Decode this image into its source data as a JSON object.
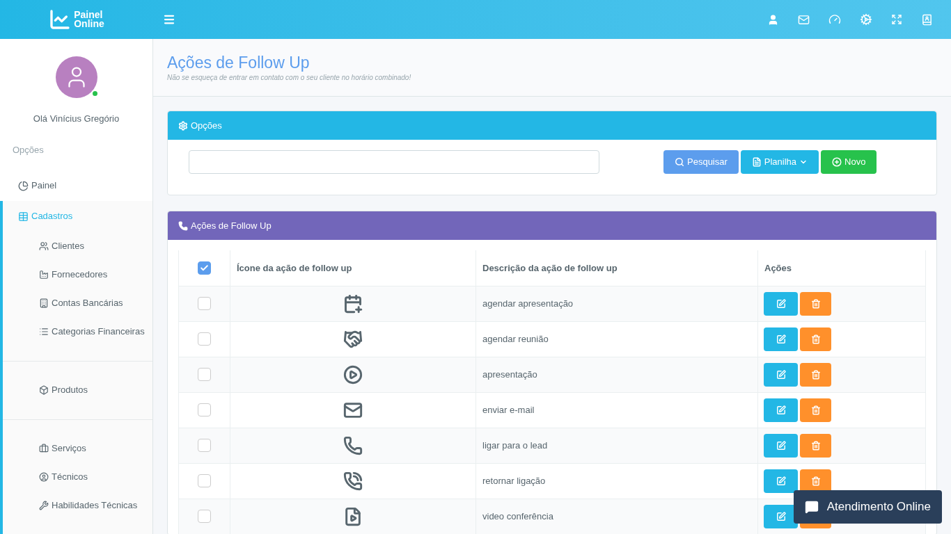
{
  "logo": {
    "line1": "Painel",
    "line2": "Online"
  },
  "user": {
    "greeting": "Olá Vinícius Gregório",
    "online": true
  },
  "sidebar": {
    "section_label": "Opções",
    "items": [
      {
        "label": "Painel",
        "selected": false
      },
      {
        "label": "Cadastros",
        "selected": true,
        "groups": [
          {
            "children": [
              {
                "label": "Clientes"
              },
              {
                "label": "Fornecedores"
              },
              {
                "label": "Contas Bancárias"
              },
              {
                "label": "Categorias Financeiras"
              }
            ]
          },
          {
            "children": [
              {
                "label": "Produtos"
              }
            ]
          },
          {
            "children": [
              {
                "label": "Serviços"
              },
              {
                "label": "Técnicos"
              },
              {
                "label": "Habilidades Técnicas"
              }
            ]
          }
        ]
      }
    ]
  },
  "page": {
    "title": "Ações de Follow Up",
    "subtitle": "Não se esqueça de entrar em contato com o seu cliente no horário combinado!"
  },
  "options_panel": {
    "title": "Opções",
    "buttons": [
      {
        "label": "Pesquisar",
        "kind": "search"
      },
      {
        "label": "Planilha",
        "kind": "dropdown"
      },
      {
        "label": "Novo",
        "kind": "new"
      }
    ]
  },
  "table_panel": {
    "title": "Ações de Follow Up",
    "columns": [
      "Ícone da ação de follow up",
      "Descrição da ação de follow up",
      "Ações"
    ],
    "all_checked": true,
    "rows": [
      {
        "description": "agendar apresentação",
        "checked": false
      },
      {
        "description": "agendar reunião",
        "checked": false
      },
      {
        "description": "apresentação",
        "checked": false
      },
      {
        "description": "enviar e-mail",
        "checked": false
      },
      {
        "description": "ligar para o lead",
        "checked": false
      },
      {
        "description": "retornar ligação",
        "checked": false
      },
      {
        "description": "video conferência",
        "checked": false
      }
    ]
  },
  "chat_widget": {
    "label": "Atendimento Online"
  }
}
